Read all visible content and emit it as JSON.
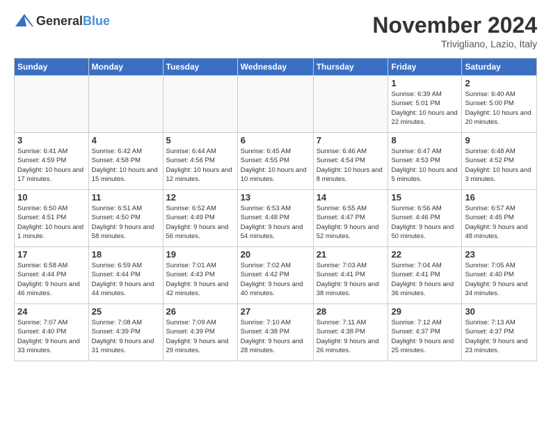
{
  "header": {
    "logo_general": "General",
    "logo_blue": "Blue",
    "month_title": "November 2024",
    "location": "Trivigliano, Lazio, Italy"
  },
  "days_of_week": [
    "Sunday",
    "Monday",
    "Tuesday",
    "Wednesday",
    "Thursday",
    "Friday",
    "Saturday"
  ],
  "weeks": [
    [
      {
        "day": "",
        "info": ""
      },
      {
        "day": "",
        "info": ""
      },
      {
        "day": "",
        "info": ""
      },
      {
        "day": "",
        "info": ""
      },
      {
        "day": "",
        "info": ""
      },
      {
        "day": "1",
        "info": "Sunrise: 6:39 AM\nSunset: 5:01 PM\nDaylight: 10 hours and 22 minutes."
      },
      {
        "day": "2",
        "info": "Sunrise: 6:40 AM\nSunset: 5:00 PM\nDaylight: 10 hours and 20 minutes."
      }
    ],
    [
      {
        "day": "3",
        "info": "Sunrise: 6:41 AM\nSunset: 4:59 PM\nDaylight: 10 hours and 17 minutes."
      },
      {
        "day": "4",
        "info": "Sunrise: 6:42 AM\nSunset: 4:58 PM\nDaylight: 10 hours and 15 minutes."
      },
      {
        "day": "5",
        "info": "Sunrise: 6:44 AM\nSunset: 4:56 PM\nDaylight: 10 hours and 12 minutes."
      },
      {
        "day": "6",
        "info": "Sunrise: 6:45 AM\nSunset: 4:55 PM\nDaylight: 10 hours and 10 minutes."
      },
      {
        "day": "7",
        "info": "Sunrise: 6:46 AM\nSunset: 4:54 PM\nDaylight: 10 hours and 8 minutes."
      },
      {
        "day": "8",
        "info": "Sunrise: 6:47 AM\nSunset: 4:53 PM\nDaylight: 10 hours and 5 minutes."
      },
      {
        "day": "9",
        "info": "Sunrise: 6:48 AM\nSunset: 4:52 PM\nDaylight: 10 hours and 3 minutes."
      }
    ],
    [
      {
        "day": "10",
        "info": "Sunrise: 6:50 AM\nSunset: 4:51 PM\nDaylight: 10 hours and 1 minute."
      },
      {
        "day": "11",
        "info": "Sunrise: 6:51 AM\nSunset: 4:50 PM\nDaylight: 9 hours and 58 minutes."
      },
      {
        "day": "12",
        "info": "Sunrise: 6:52 AM\nSunset: 4:49 PM\nDaylight: 9 hours and 56 minutes."
      },
      {
        "day": "13",
        "info": "Sunrise: 6:53 AM\nSunset: 4:48 PM\nDaylight: 9 hours and 54 minutes."
      },
      {
        "day": "14",
        "info": "Sunrise: 6:55 AM\nSunset: 4:47 PM\nDaylight: 9 hours and 52 minutes."
      },
      {
        "day": "15",
        "info": "Sunrise: 6:56 AM\nSunset: 4:46 PM\nDaylight: 9 hours and 50 minutes."
      },
      {
        "day": "16",
        "info": "Sunrise: 6:57 AM\nSunset: 4:45 PM\nDaylight: 9 hours and 48 minutes."
      }
    ],
    [
      {
        "day": "17",
        "info": "Sunrise: 6:58 AM\nSunset: 4:44 PM\nDaylight: 9 hours and 46 minutes."
      },
      {
        "day": "18",
        "info": "Sunrise: 6:59 AM\nSunset: 4:44 PM\nDaylight: 9 hours and 44 minutes."
      },
      {
        "day": "19",
        "info": "Sunrise: 7:01 AM\nSunset: 4:43 PM\nDaylight: 9 hours and 42 minutes."
      },
      {
        "day": "20",
        "info": "Sunrise: 7:02 AM\nSunset: 4:42 PM\nDaylight: 9 hours and 40 minutes."
      },
      {
        "day": "21",
        "info": "Sunrise: 7:03 AM\nSunset: 4:41 PM\nDaylight: 9 hours and 38 minutes."
      },
      {
        "day": "22",
        "info": "Sunrise: 7:04 AM\nSunset: 4:41 PM\nDaylight: 9 hours and 36 minutes."
      },
      {
        "day": "23",
        "info": "Sunrise: 7:05 AM\nSunset: 4:40 PM\nDaylight: 9 hours and 34 minutes."
      }
    ],
    [
      {
        "day": "24",
        "info": "Sunrise: 7:07 AM\nSunset: 4:40 PM\nDaylight: 9 hours and 33 minutes."
      },
      {
        "day": "25",
        "info": "Sunrise: 7:08 AM\nSunset: 4:39 PM\nDaylight: 9 hours and 31 minutes."
      },
      {
        "day": "26",
        "info": "Sunrise: 7:09 AM\nSunset: 4:39 PM\nDaylight: 9 hours and 29 minutes."
      },
      {
        "day": "27",
        "info": "Sunrise: 7:10 AM\nSunset: 4:38 PM\nDaylight: 9 hours and 28 minutes."
      },
      {
        "day": "28",
        "info": "Sunrise: 7:11 AM\nSunset: 4:38 PM\nDaylight: 9 hours and 26 minutes."
      },
      {
        "day": "29",
        "info": "Sunrise: 7:12 AM\nSunset: 4:37 PM\nDaylight: 9 hours and 25 minutes."
      },
      {
        "day": "30",
        "info": "Sunrise: 7:13 AM\nSunset: 4:37 PM\nDaylight: 9 hours and 23 minutes."
      }
    ]
  ]
}
